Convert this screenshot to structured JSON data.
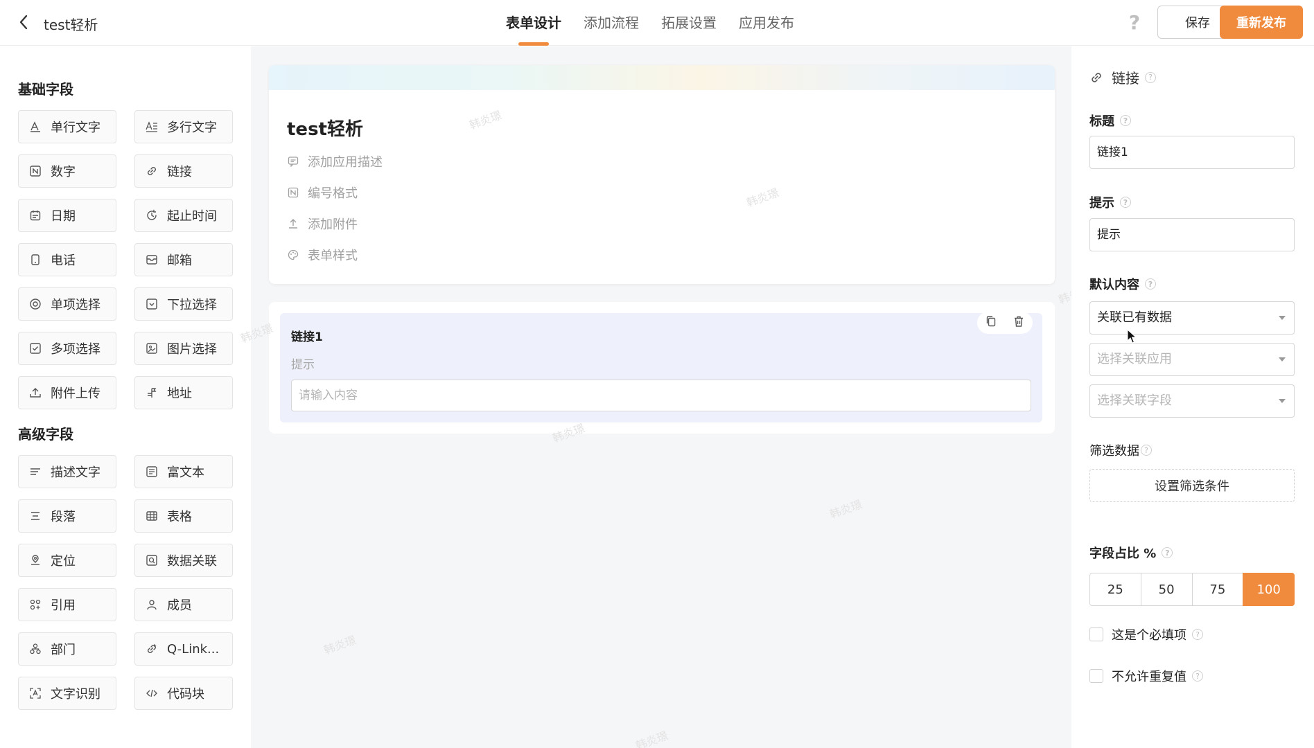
{
  "header": {
    "app_title": "test轻析",
    "tabs": [
      {
        "label": "表单设计",
        "active": true
      },
      {
        "label": "添加流程",
        "active": false
      },
      {
        "label": "拓展设置",
        "active": false
      },
      {
        "label": "应用发布",
        "active": false
      }
    ],
    "help_icon": "?",
    "save_label": "保存",
    "publish_label": "重新发布"
  },
  "colors": {
    "accent": "#f08a3c"
  },
  "left_panel": {
    "basic_title": "基础字段",
    "basic_fields": [
      {
        "label": "单行文字",
        "icon": "single-line-text-icon"
      },
      {
        "label": "多行文字",
        "icon": "multi-line-text-icon"
      },
      {
        "label": "数字",
        "icon": "number-icon"
      },
      {
        "label": "链接",
        "icon": "link-icon"
      },
      {
        "label": "日期",
        "icon": "calendar-icon"
      },
      {
        "label": "起止时间",
        "icon": "time-range-icon"
      },
      {
        "label": "电话",
        "icon": "phone-icon"
      },
      {
        "label": "邮箱",
        "icon": "mail-icon"
      },
      {
        "label": "单项选择",
        "icon": "radio-icon"
      },
      {
        "label": "下拉选择",
        "icon": "dropdown-icon"
      },
      {
        "label": "多项选择",
        "icon": "checkbox-icon"
      },
      {
        "label": "图片选择",
        "icon": "image-icon"
      },
      {
        "label": "附件上传",
        "icon": "upload-icon"
      },
      {
        "label": "地址",
        "icon": "address-icon"
      }
    ],
    "advanced_title": "高级字段",
    "advanced_fields": [
      {
        "label": "描述文字",
        "icon": "description-icon"
      },
      {
        "label": "富文本",
        "icon": "rich-text-icon"
      },
      {
        "label": "段落",
        "icon": "paragraph-icon"
      },
      {
        "label": "表格",
        "icon": "table-icon"
      },
      {
        "label": "定位",
        "icon": "location-icon"
      },
      {
        "label": "数据关联",
        "icon": "data-link-icon"
      },
      {
        "label": "引用",
        "icon": "reference-icon"
      },
      {
        "label": "成员",
        "icon": "member-icon"
      },
      {
        "label": "部门",
        "icon": "department-icon"
      },
      {
        "label": "Q-Link...",
        "icon": "qlink-icon"
      },
      {
        "label": "文字识别",
        "icon": "ocr-icon"
      },
      {
        "label": "代码块",
        "icon": "code-icon"
      }
    ]
  },
  "canvas": {
    "form_title": "test轻析",
    "actions": [
      {
        "label": "添加应用描述",
        "icon": "comment-icon"
      },
      {
        "label": "编号格式",
        "icon": "number-format-icon"
      },
      {
        "label": "添加附件",
        "icon": "attachment-upload-icon"
      },
      {
        "label": "表单样式",
        "icon": "palette-icon"
      }
    ],
    "field": {
      "title": "链接1",
      "hint": "提示",
      "placeholder": "请输入内容"
    },
    "watermark": "韩炎璟"
  },
  "right_panel": {
    "header_label": "链接",
    "title_label": "标题",
    "title_value": "链接1",
    "hint_label": "提示",
    "hint_value": "提示",
    "default_label": "默认内容",
    "default_value": "关联已有数据",
    "app_select_placeholder": "选择关联应用",
    "field_select_placeholder": "选择关联字段",
    "filter_label": "筛选数据",
    "filter_button": "设置筛选条件",
    "width_label": "字段占比 %",
    "width_options": [
      "25",
      "50",
      "75",
      "100"
    ],
    "width_selected": "100",
    "required_label": "这是个必填项",
    "unique_label": "不允许重复值"
  }
}
